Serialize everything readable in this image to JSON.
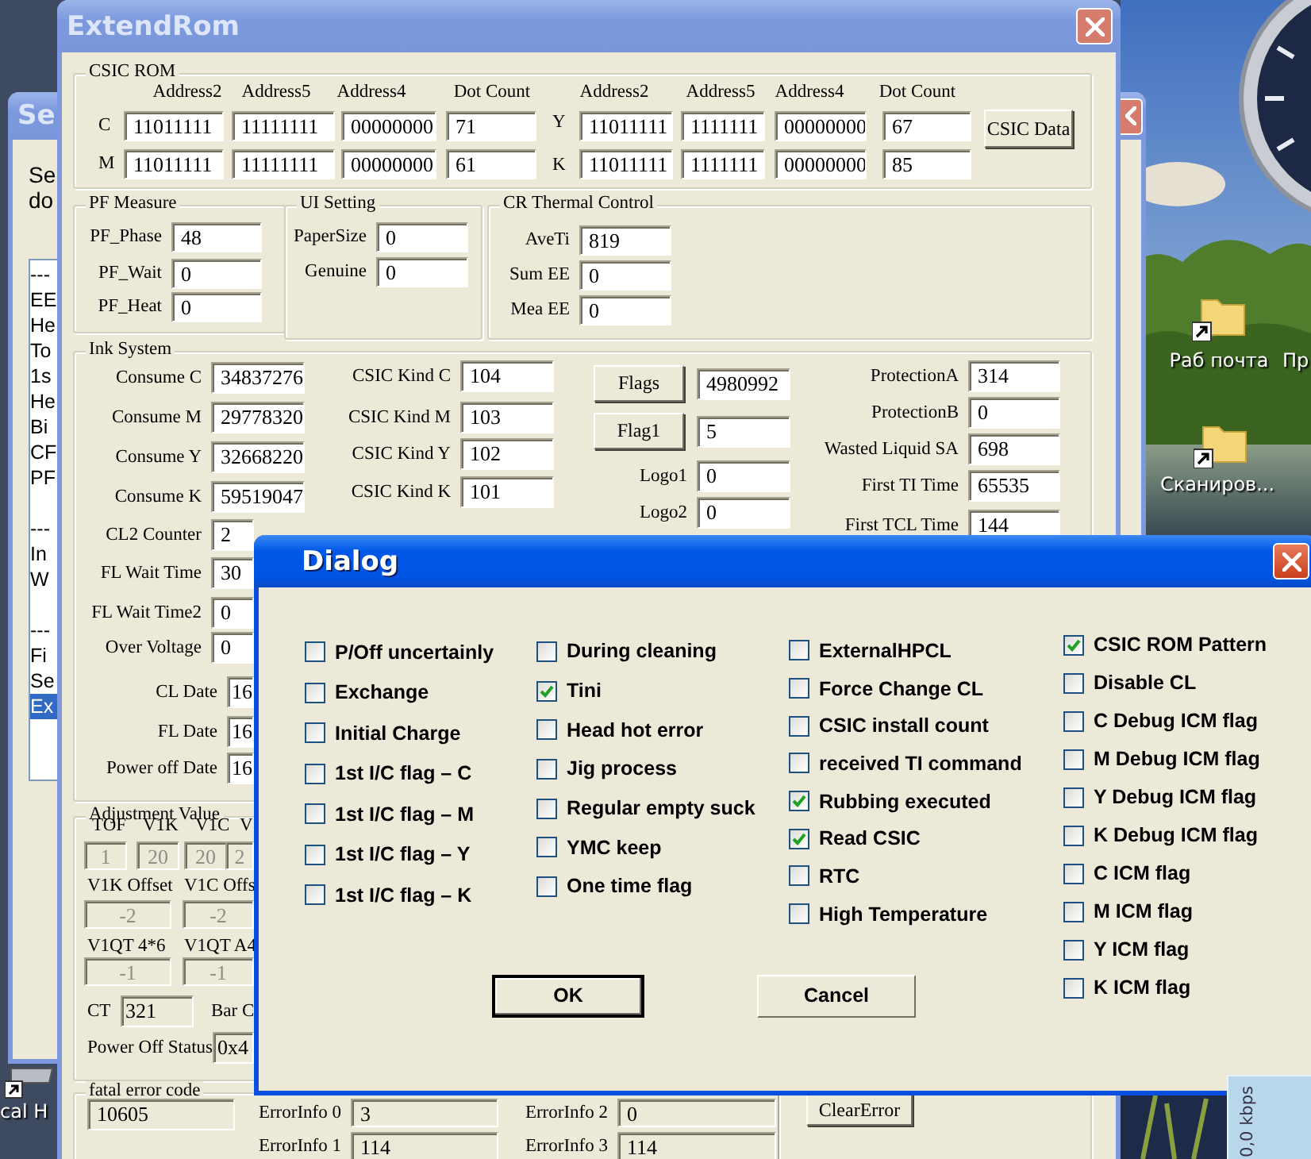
{
  "background_window": {
    "title": "Se",
    "text_lines": [
      "Se",
      "do"
    ],
    "list_groups": [
      [
        {
          "label": "---",
          "selected": false
        },
        {
          "label": "EE",
          "selected": false
        },
        {
          "label": "He",
          "selected": false
        },
        {
          "label": "To",
          "selected": false
        },
        {
          "label": "1s",
          "selected": false
        },
        {
          "label": "He",
          "selected": false
        },
        {
          "label": "Bi",
          "selected": false
        },
        {
          "label": "CF",
          "selected": false
        },
        {
          "label": "PF",
          "selected": false
        }
      ],
      [
        {
          "label": "---",
          "selected": false
        },
        {
          "label": "In",
          "selected": false
        },
        {
          "label": "W",
          "selected": false
        }
      ],
      [
        {
          "label": "---",
          "selected": false
        },
        {
          "label": "Fi",
          "selected": false
        },
        {
          "label": "Se",
          "selected": false
        },
        {
          "label": "Ex",
          "selected": true
        }
      ]
    ]
  },
  "extendrom": {
    "title": "ExtendRom",
    "csic_rom": {
      "title": "CSIC ROM",
      "headers": [
        "Address2",
        "Address5",
        "Address4",
        "Dot Count",
        "Address2",
        "Address5",
        "Address4",
        "Dot Count"
      ],
      "rows": [
        {
          "label": "C",
          "values": [
            "11011111",
            "11111111",
            "00000000",
            "71"
          ]
        },
        {
          "label": "M",
          "values": [
            "11011111",
            "11111111",
            "00000000",
            "61"
          ]
        },
        {
          "label": "Y",
          "values": [
            "11011111",
            "1111111",
            "00000000",
            "67"
          ]
        },
        {
          "label": "K",
          "values": [
            "11011111",
            "1111111",
            "00000000",
            "85"
          ]
        }
      ],
      "button": "CSIC Data"
    },
    "pf_measure": {
      "title": "PF Measure",
      "fields": [
        {
          "label": "PF_Phase",
          "value": "48"
        },
        {
          "label": "PF_Wait",
          "value": "0"
        },
        {
          "label": "PF_Heat",
          "value": "0"
        }
      ]
    },
    "ui_setting": {
      "title": "UI Setting",
      "fields": [
        {
          "label": "PaperSize",
          "value": "0"
        },
        {
          "label": "Genuine",
          "value": "0"
        }
      ]
    },
    "cr_thermal_control": {
      "title": "CR Thermal Control",
      "fields": [
        {
          "label": "AveTi",
          "value": "819"
        },
        {
          "label": "Sum EE",
          "value": "0"
        },
        {
          "label": "Mea EE",
          "value": "0"
        }
      ]
    },
    "ink_system": {
      "title": "Ink System",
      "fields": [
        {
          "label": "Consume C",
          "value": "34837276"
        },
        {
          "label": "Consume M",
          "value": "29778320"
        },
        {
          "label": "Consume Y",
          "value": "32668220"
        },
        {
          "label": "Consume K",
          "value": "59519047"
        },
        {
          "label": "CL2 Counter",
          "value": "2"
        },
        {
          "label": "FL Wait Time",
          "value": "30"
        },
        {
          "label": "FL Wait Time2",
          "value": "0"
        },
        {
          "label": "Over Voltage",
          "value": "0"
        },
        {
          "label": "CL Date",
          "value": "16"
        },
        {
          "label": "FL Date",
          "value": "16"
        },
        {
          "label": "Power off Date",
          "value": "16"
        },
        {
          "label": "CSIC Kind C",
          "value": "104"
        },
        {
          "label": "CSIC Kind M",
          "value": "103"
        },
        {
          "label": "CSIC Kind Y",
          "value": "102"
        },
        {
          "label": "CSIC Kind K",
          "value": "101"
        },
        {
          "label": "Logo1",
          "value": "0"
        },
        {
          "label": "Logo2",
          "value": "0"
        },
        {
          "label": "ProtectionA",
          "value": "314"
        },
        {
          "label": "ProtectionB",
          "value": "0"
        },
        {
          "label": "Wasted Liquid SA",
          "value": "698"
        },
        {
          "label": "First TI Time",
          "value": "65535"
        },
        {
          "label": "First TCL Time",
          "value": "144"
        }
      ],
      "buttons": [
        {
          "label": "Flags",
          "value": "4980992"
        },
        {
          "label": "Flag1",
          "value": "5"
        }
      ]
    },
    "adjustment_value": {
      "title": "Adjustment Value",
      "headers": [
        "TOF",
        "V1K",
        "V1C",
        "V"
      ],
      "values": [
        {
          "value": "1",
          "disabled": true
        },
        {
          "value": "20",
          "disabled": true
        },
        {
          "value": "20",
          "disabled": true
        },
        {
          "value": "2",
          "disabled": true
        }
      ],
      "fields": [
        {
          "label": "V1K Offset",
          "value": "-2",
          "disabled": true
        },
        {
          "label": "V1C Offs",
          "value": "-2",
          "disabled": true
        },
        {
          "label": "V1QT 4*6",
          "value": "-1",
          "disabled": true
        },
        {
          "label": "V1QT A4",
          "value": "-1",
          "disabled": true
        },
        {
          "label": "CT",
          "value": "321",
          "disabled": false
        },
        {
          "label": "Bar C"
        },
        {
          "label": "Power Off Status",
          "value": "0x4",
          "disabled": false
        }
      ]
    },
    "fatal_error_code": {
      "title": "fatal error code",
      "value": "10605",
      "error_info": [
        {
          "label": "ErrorInfo 0",
          "value": "3"
        },
        {
          "label": "ErrorInfo 1",
          "value": "114"
        },
        {
          "label": "ErrorInfo 2",
          "value": "0"
        },
        {
          "label": "ErrorInfo 3",
          "value": "114"
        }
      ],
      "button": "ClearError"
    }
  },
  "dialog": {
    "title": "Dialog",
    "columns": [
      [
        {
          "label": "P/Off uncertainly",
          "checked": false
        },
        {
          "label": "Exchange",
          "checked": false
        },
        {
          "label": "Initial Charge",
          "checked": false
        },
        {
          "label": "1st I/C flag – C",
          "checked": false
        },
        {
          "label": "1st I/C flag – M",
          "checked": false
        },
        {
          "label": "1st I/C flag – Y",
          "checked": false
        },
        {
          "label": "1st I/C flag – K",
          "checked": false
        }
      ],
      [
        {
          "label": "During cleaning",
          "checked": false
        },
        {
          "label": "Tini",
          "checked": true
        },
        {
          "label": "Head hot error",
          "checked": false
        },
        {
          "label": "Jig process",
          "checked": false
        },
        {
          "label": "Regular empty suck",
          "checked": false
        },
        {
          "label": "YMC keep",
          "checked": false
        },
        {
          "label": "One time flag",
          "checked": false
        }
      ],
      [
        {
          "label": "ExternalHPCL",
          "checked": false
        },
        {
          "label": "Force Change CL",
          "checked": false
        },
        {
          "label": "CSIC install count",
          "checked": false
        },
        {
          "label": "received TI command",
          "checked": false
        },
        {
          "label": "Rubbing executed",
          "checked": true
        },
        {
          "label": "Read CSIC",
          "checked": true
        },
        {
          "label": "RTC",
          "checked": false
        },
        {
          "label": "High Temperature",
          "checked": false
        }
      ],
      [
        {
          "label": "CSIC ROM Pattern",
          "checked": true
        },
        {
          "label": "Disable CL",
          "checked": false
        },
        {
          "label": "C Debug ICM flag",
          "checked": false
        },
        {
          "label": "M Debug ICM flag",
          "checked": false
        },
        {
          "label": "Y Debug ICM flag",
          "checked": false
        },
        {
          "label": "K Debug ICM flag",
          "checked": false
        },
        {
          "label": "C ICM flag",
          "checked": false
        },
        {
          "label": "M ICM flag",
          "checked": false
        },
        {
          "label": "Y ICM flag",
          "checked": false
        },
        {
          "label": "K ICM flag",
          "checked": false
        }
      ]
    ],
    "buttons": [
      {
        "label": "OK",
        "kind": "default"
      },
      {
        "label": "Cancel",
        "kind": "normal"
      }
    ]
  },
  "desktop": {
    "icons": [
      {
        "label": "Раб почта",
        "kind": "folder"
      },
      {
        "label": "Пр",
        "kind": "cut"
      },
      {
        "label": "Сканиров...",
        "kind": "folder"
      },
      {
        "label": "cal H",
        "kind": "drive"
      }
    ],
    "network_gadget": {
      "reading": "0,0 kbps"
    }
  }
}
